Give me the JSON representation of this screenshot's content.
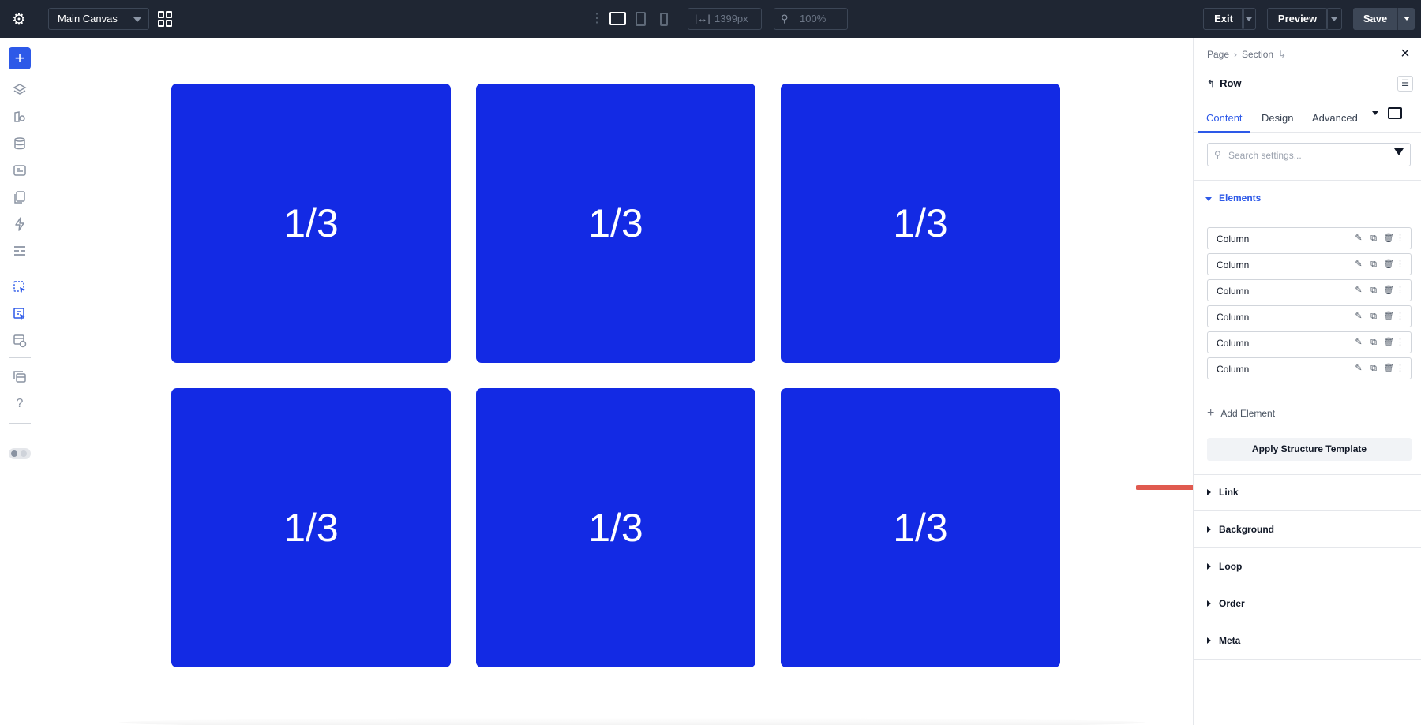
{
  "topbar": {
    "canvas_select": "Main Canvas",
    "width_value": "1399px",
    "zoom_value": "100%",
    "exit_label": "Exit",
    "preview_label": "Preview",
    "save_label": "Save"
  },
  "leftbar": {
    "icons": [
      "add-icon",
      "layers-icon",
      "styles-icon",
      "database-icon",
      "template-icon",
      "pages-icon",
      "lightning-icon",
      "sections-icon",
      "component-icon",
      "component-group-icon",
      "visibility-icon",
      "stack-icon",
      "help-icon",
      "toggle-icon"
    ],
    "help_glyph": "?"
  },
  "canvas": {
    "tiles": [
      "1/3",
      "1/3",
      "1/3",
      "1/3",
      "1/3",
      "1/3"
    ],
    "tile_color": "#132ae4",
    "arrow_color": "#e05a4f"
  },
  "panel": {
    "breadcrumb": [
      "Page",
      "Section"
    ],
    "breadcrumb_sep": "›",
    "title": "Row",
    "tabs": [
      "Content",
      "Design",
      "Advanced"
    ],
    "active_tab": "Content",
    "search_placeholder": "Search settings...",
    "elements_section": "Elements",
    "elements": [
      "Column",
      "Column",
      "Column",
      "Column",
      "Column",
      "Column"
    ],
    "add_element": "Add Element",
    "apply_template": "Apply Structure Template",
    "collapsed_sections": [
      "Link",
      "Background",
      "Loop",
      "Order",
      "Meta"
    ],
    "accent_color": "#2d59e8"
  }
}
